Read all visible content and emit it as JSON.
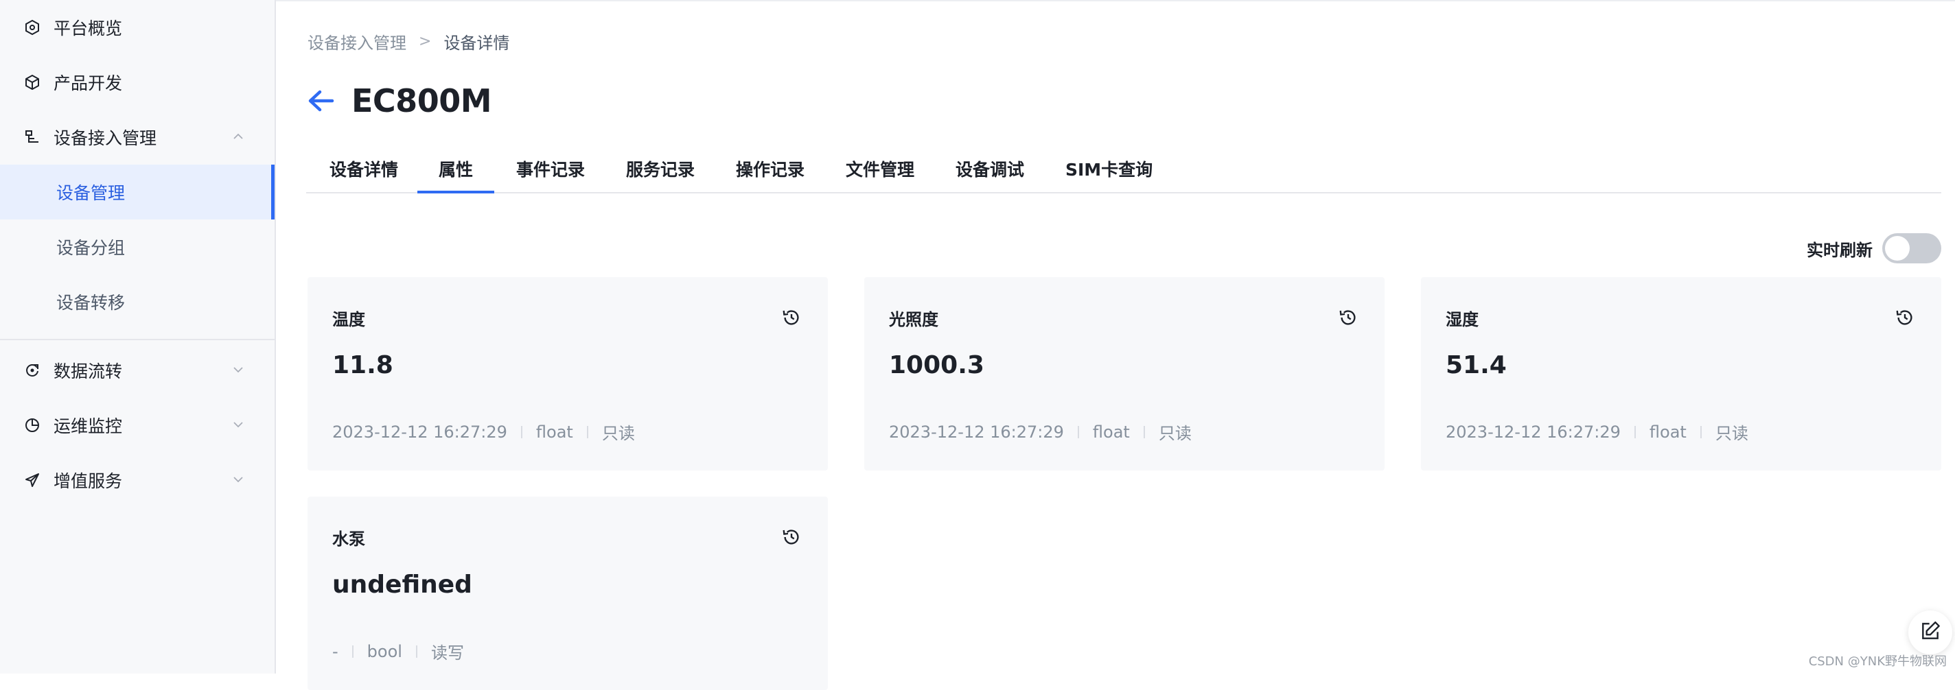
{
  "sidebar": {
    "items": [
      {
        "label": "平台概览",
        "icon": "overview-icon"
      },
      {
        "label": "产品开发",
        "icon": "box-icon"
      },
      {
        "label": "设备接入管理",
        "icon": "device-access-icon",
        "expanded": true,
        "children": [
          {
            "label": "设备管理",
            "active": true
          },
          {
            "label": "设备分组"
          },
          {
            "label": "设备转移"
          }
        ]
      },
      {
        "label": "数据流转",
        "icon": "data-flow-icon"
      },
      {
        "label": "运维监控",
        "icon": "monitor-icon"
      },
      {
        "label": "增值服务",
        "icon": "send-icon"
      }
    ]
  },
  "breadcrumb": {
    "parent": "设备接入管理",
    "separator": ">",
    "current": "设备详情"
  },
  "page_title": "EC800M",
  "tabs": [
    {
      "label": "设备详情"
    },
    {
      "label": "属性",
      "active": true
    },
    {
      "label": "事件记录"
    },
    {
      "label": "服务记录"
    },
    {
      "label": "操作记录"
    },
    {
      "label": "文件管理"
    },
    {
      "label": "设备调试"
    },
    {
      "label": "SIM卡查询"
    }
  ],
  "realtime_refresh": {
    "label": "实时刷新",
    "enabled": false
  },
  "properties": [
    {
      "name": "温度",
      "value": "11.8",
      "time": "2023-12-12 16:27:29",
      "type": "float",
      "access": "只读"
    },
    {
      "name": "光照度",
      "value": "1000.3",
      "time": "2023-12-12 16:27:29",
      "type": "float",
      "access": "只读"
    },
    {
      "name": "湿度",
      "value": "51.4",
      "time": "2023-12-12 16:27:29",
      "type": "float",
      "access": "只读"
    },
    {
      "name": "水泵",
      "value": "undefined",
      "time": "-",
      "type": "bool",
      "access": "读写"
    }
  ],
  "watermark": "CSDN @YNK野牛物联网",
  "colors": {
    "accent": "#2f6bf3",
    "sidebar_bg": "#f7f8fa",
    "card_bg": "#f7f8fa",
    "active_bg": "#e8effe"
  }
}
